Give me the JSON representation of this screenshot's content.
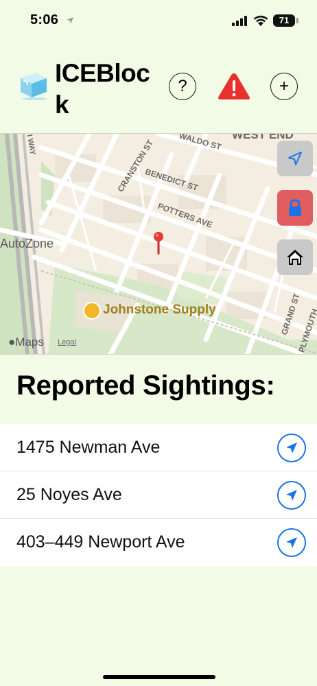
{
  "status_bar": {
    "time": "5:06",
    "battery": "71"
  },
  "header": {
    "app_title": "ICEBlock",
    "help_label": "?",
    "add_label": "+"
  },
  "map": {
    "street_labels": [
      "WEST END",
      "WALDO ST",
      "CRANSTON ST",
      "BENEDICT ST",
      "POTTERS AVE",
      "GRAND ST",
      "PLYMOUTH",
      "I WAY"
    ],
    "poi_label": "Johnstone Supply",
    "store_label": "AutoZone",
    "maps_brand": "Maps",
    "legal_link": "Legal"
  },
  "section": {
    "title": "Reported Sightings:"
  },
  "sightings": [
    {
      "address": "1475 Newman Ave"
    },
    {
      "address": "25 Noyes Ave"
    },
    {
      "address": "403–449 Newport Ave"
    }
  ],
  "colors": {
    "background": "#f2fbe5",
    "alert_red": "#e8312d",
    "lock_bg": "#e05d60",
    "nav_blue": "#1a73e8"
  }
}
